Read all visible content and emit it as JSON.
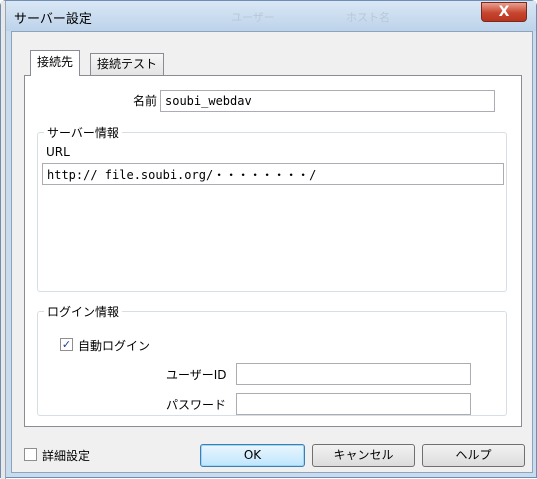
{
  "window": {
    "title": "サーバー設定",
    "ghost_title_1": "ユーザー",
    "ghost_title_2": "ホスト名",
    "close_label": "X"
  },
  "tabs": [
    {
      "label": "接続先",
      "active": true
    },
    {
      "label": "接続テスト",
      "active": false
    }
  ],
  "connection": {
    "name_label": "名前",
    "name_value": "soubi_webdav"
  },
  "server_info": {
    "group_title": "サーバー情報",
    "url_label": "URL",
    "url_value": "http:// file.soubi.org/・・・・・・・・/"
  },
  "login_info": {
    "group_title": "ログイン情報",
    "auto_login_label": "自動ログイン",
    "auto_login_checked": true,
    "user_id_label": "ユーザーID",
    "user_id_value": "",
    "password_label": "パスワード",
    "password_value": ""
  },
  "footer": {
    "advanced_label": "詳細設定",
    "advanced_checked": false,
    "ok_label": "OK",
    "cancel_label": "キャンセル",
    "help_label": "ヘルプ"
  },
  "colors": {
    "close_button": "#c7452f",
    "window_frame": "#bdd3ea",
    "checkmark": "#1e3f96"
  }
}
